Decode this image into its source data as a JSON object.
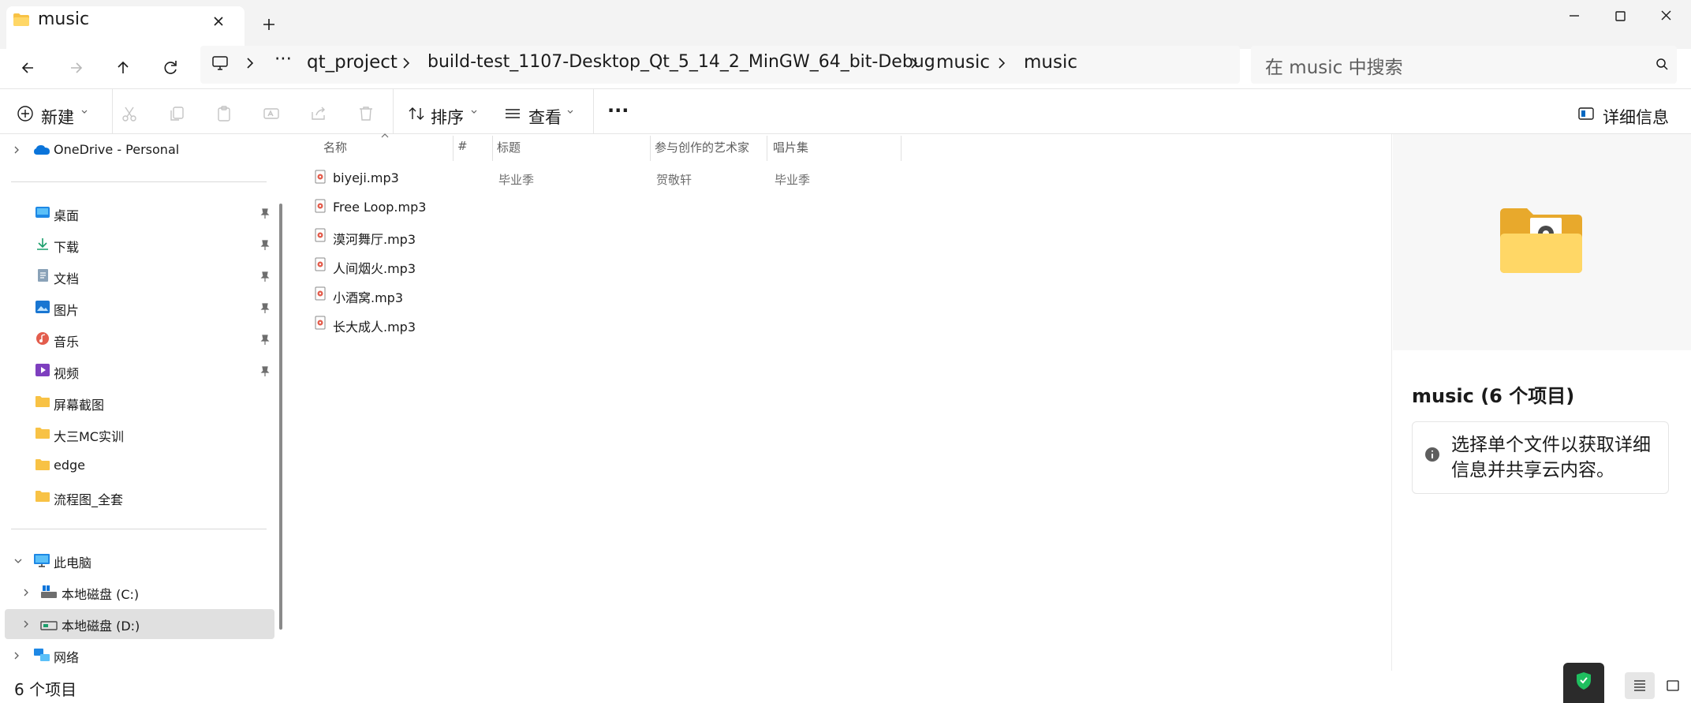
{
  "window": {
    "tab_title": "music",
    "new_tab_symbol": "+",
    "colors": {
      "accent": "#0067c0",
      "folder": "#f8c245",
      "chrome_bg": "#f3f3f3",
      "selection_bg": "#e0e0e0"
    }
  },
  "breadcrumb": {
    "overflow": "···",
    "items": [
      "qt_project",
      "build-test_1107-Desktop_Qt_5_14_2_MinGW_64_bit-Debug",
      "music",
      "music"
    ]
  },
  "search": {
    "placeholder": "在 music 中搜索"
  },
  "commandbar": {
    "new_label": "新建",
    "sort_label": "排序",
    "view_label": "查看",
    "more_label": "···",
    "details_label": "详细信息"
  },
  "sidebar": {
    "onedrive": "OneDrive - Personal",
    "quick_access": [
      {
        "label": "桌面",
        "icon": "desktop-icon",
        "pinned": true
      },
      {
        "label": "下载",
        "icon": "download-icon",
        "pinned": true
      },
      {
        "label": "文档",
        "icon": "document-icon",
        "pinned": true
      },
      {
        "label": "图片",
        "icon": "pictures-icon",
        "pinned": true
      },
      {
        "label": "音乐",
        "icon": "music-icon",
        "pinned": true
      },
      {
        "label": "视频",
        "icon": "video-icon",
        "pinned": true
      },
      {
        "label": "屏幕截图",
        "icon": "folder-icon",
        "pinned": false
      },
      {
        "label": "大三MC实训",
        "icon": "folder-icon",
        "pinned": false
      },
      {
        "label": "edge",
        "icon": "folder-icon",
        "pinned": false
      },
      {
        "label": "流程图_全套",
        "icon": "folder-icon",
        "pinned": false
      }
    ],
    "this_pc": "此电脑",
    "drives": [
      "本地磁盘 (C:)",
      "本地磁盘 (D:)"
    ],
    "network": "网络"
  },
  "filelist": {
    "columns": [
      "名称",
      "#",
      "标题",
      "参与创作的艺术家",
      "唱片集"
    ],
    "rows": [
      {
        "name": "biyeji.mp3",
        "number": "",
        "title": "毕业季",
        "artist": "贺敬轩",
        "album": "毕业季"
      },
      {
        "name": "Free Loop.mp3",
        "number": "",
        "title": "",
        "artist": "",
        "album": ""
      },
      {
        "name": "漠河舞厅.mp3",
        "number": "",
        "title": "",
        "artist": "",
        "album": ""
      },
      {
        "name": "人间烟火.mp3",
        "number": "",
        "title": "",
        "artist": "",
        "album": ""
      },
      {
        "name": "小酒窝.mp3",
        "number": "",
        "title": "",
        "artist": "",
        "album": ""
      },
      {
        "name": "长大成人.mp3",
        "number": "",
        "title": "",
        "artist": "",
        "album": ""
      }
    ]
  },
  "details": {
    "title": "music (6 个项目)",
    "info": "选择单个文件以获取详细信息并共享云内容。"
  },
  "statusbar": {
    "count_text": "6 个项目"
  }
}
